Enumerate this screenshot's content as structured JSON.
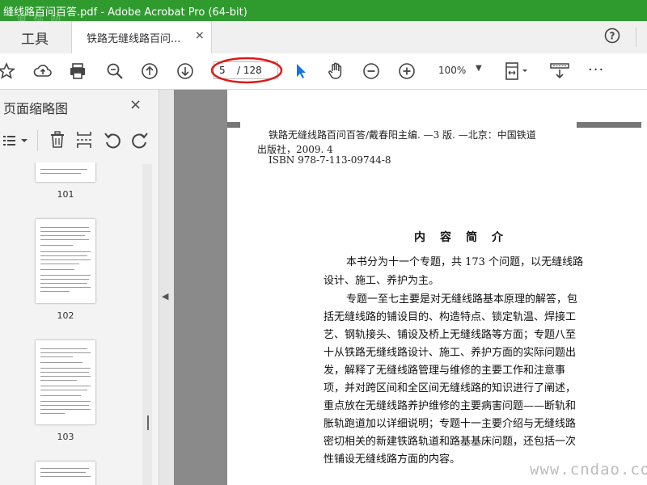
{
  "window": {
    "title": "缝线路百问百答.pdf - Adobe Acrobat Pro (64-bit)",
    "watermark_top": "道 标 网",
    "titlebar_color": "#2f9b2f",
    "frame_color": "#f2f200"
  },
  "tabs": {
    "tools_label": "工具",
    "doc_label": "铁路无缝线路百问...",
    "close_glyph": "×",
    "help_icon": "help-icon"
  },
  "toolbar": {
    "icons": [
      "star-icon",
      "upload-cloud-icon",
      "print-icon",
      "zoom-search-icon",
      "page-up-icon",
      "page-down-icon",
      "select-arrow-icon",
      "hand-icon",
      "zoom-out-icon",
      "zoom-in-icon",
      "fit-page-icon",
      "scroll-mode-icon",
      "more-icon"
    ],
    "page_current": "5",
    "page_total": "/ 128",
    "zoom_value": "100%",
    "zoom_caret": "▼",
    "more_label": "···",
    "accent_color": "#1473e6",
    "annotation_color": "#e11919"
  },
  "sidebar": {
    "title": "页面缩略图",
    "close_glyph": "×",
    "tools": [
      "options-menu-icon",
      "delete-icon",
      "extract-icon",
      "rotate-ccw-icon",
      "rotate-cw-icon"
    ],
    "thumbnails": [
      {
        "page": "101"
      },
      {
        "page": "102"
      },
      {
        "page": "103"
      }
    ],
    "collapse_glyph": "◀"
  },
  "document": {
    "cip_lines": [
      "铁路无缝线路百问百答/戴春阳主编. —3 版. —北京：中国铁道",
      "出版社，2009. 4",
      "ISBN 978-7-113-09744-8"
    ],
    "heading": "内容简介",
    "body_lines": [
      "本书分为十一个专题，共 173 个问题，以无缝线路",
      "设计、施工、养护为主。",
      "专题一至七主要是对无缝线路基本原理的解答，包",
      "括无缝线路的铺设目的、构造特点、锁定轨温、焊接工",
      "艺、钢轨接头、铺设及桥上无缝线路等方面；专题八至",
      "十从铁路无缝线路设计、施工、养护方面的实际问题出",
      "发，解释了无缝线路管理与维修的主要工作和注意事",
      "项，并对跨区间和全区间无缝线路的知识进行了阐述，",
      "重点放在无缝线路养护维修的主要病害问题——断轨和",
      "胀轨跑道加以详细说明；专题十一主要介绍与无缝线路",
      "密切相关的新建铁路轨道和路基基床问题，还包括一次",
      "性铺设无缝线路方面的内容。"
    ],
    "watermark_bottom": "www.cndao.com"
  }
}
